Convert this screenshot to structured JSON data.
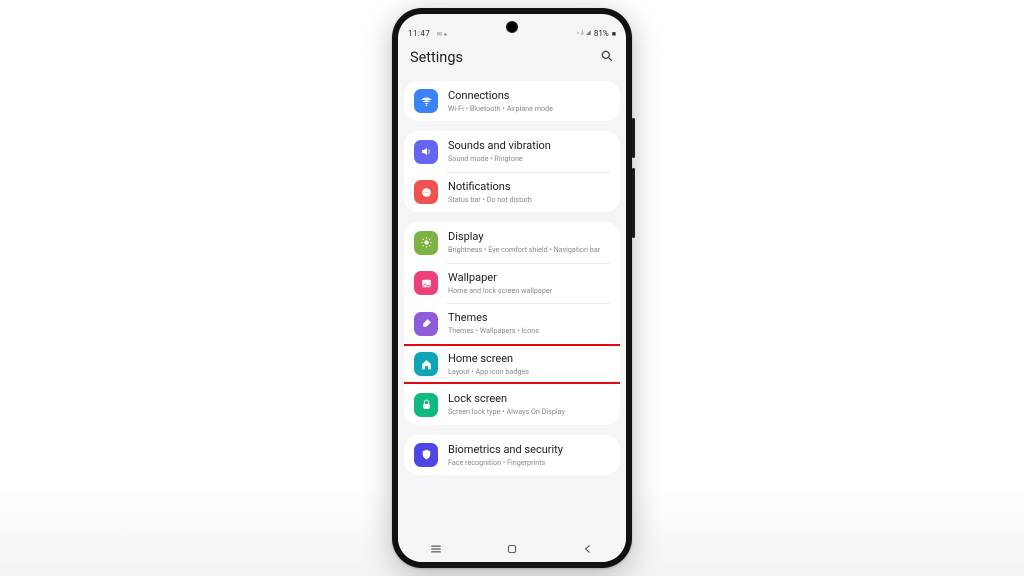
{
  "status": {
    "time": "11:47",
    "left_extra": "✉ ▸",
    "signal": "◦ ⫰ ◢",
    "battery": "81%",
    "battery_icon": "■"
  },
  "header": {
    "title": "Settings"
  },
  "colors": {
    "connections": "#3b82f6",
    "sounds": "#6366f1",
    "notifications": "#ef5350",
    "display": "#7cb342",
    "wallpaper": "#ec407a",
    "themes": "#8e5cd9",
    "home": "#0ea5b7",
    "lock": "#10b981",
    "biometrics": "#4f46e5"
  },
  "groups": [
    {
      "items": [
        {
          "id": "connections",
          "icon": "wifi-icon",
          "title": "Connections",
          "sub": "Wi-Fi  •  Bluetooth  •  Airplane mode",
          "color": "connections"
        }
      ]
    },
    {
      "items": [
        {
          "id": "sounds",
          "icon": "sound-icon",
          "title": "Sounds and vibration",
          "sub": "Sound mode  •  Ringtone",
          "color": "sounds"
        },
        {
          "id": "notifications",
          "icon": "bell-off-icon",
          "title": "Notifications",
          "sub": "Status bar  •  Do not disturb",
          "color": "notifications"
        }
      ]
    },
    {
      "items": [
        {
          "id": "display",
          "icon": "sun-icon",
          "title": "Display",
          "sub": "Brightness  •  Eye comfort shield  •  Navigation bar",
          "color": "display"
        },
        {
          "id": "wallpaper",
          "icon": "picture-icon",
          "title": "Wallpaper",
          "sub": "Home and lock screen wallpaper",
          "color": "wallpaper"
        },
        {
          "id": "themes",
          "icon": "brush-icon",
          "title": "Themes",
          "sub": "Themes  •  Wallpapers  •  Icons",
          "color": "themes"
        },
        {
          "id": "home",
          "icon": "home-icon",
          "title": "Home screen",
          "sub": "Layout  •  App icon badges",
          "color": "home",
          "highlight": true
        },
        {
          "id": "lock",
          "icon": "lock-icon",
          "title": "Lock screen",
          "sub": "Screen lock type  •  Always On Display",
          "color": "lock"
        }
      ]
    },
    {
      "items": [
        {
          "id": "biometrics",
          "icon": "shield-icon",
          "title": "Biometrics and security",
          "sub": "Face recognition  •  Fingerprints",
          "color": "biometrics"
        }
      ]
    }
  ]
}
